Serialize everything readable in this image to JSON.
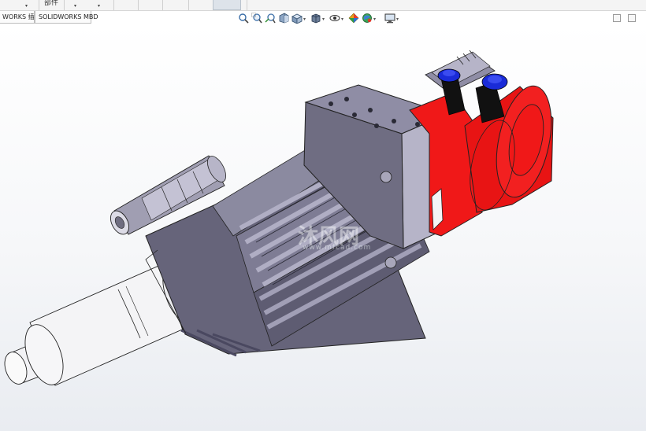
{
  "ribbon": {
    "assembly_label": "部件"
  },
  "command_tabs": [
    "WORKS 插件",
    "SOLIDWORKS MBD"
  ],
  "view_toolbar": {
    "icons": [
      "zoom-to-fit-icon",
      "zoom-to-area-icon",
      "previous-view-icon",
      "section-view-icon",
      "view-orientation-icon",
      "display-style-icon",
      "hide-show-items-icon",
      "edit-appearance-icon",
      "apply-scene-icon",
      "view-settings-icon"
    ]
  },
  "watermark": {
    "text": "沐风网",
    "url": "www.mfcad.com"
  },
  "colors": {
    "housing": "#6f6d80",
    "housing_light": "#9a98ad",
    "housing_face": "#b6b4c8",
    "red_part": "#f01818",
    "blue_cap": "#1a2bd8",
    "shaft": "#f4f4f6"
  }
}
